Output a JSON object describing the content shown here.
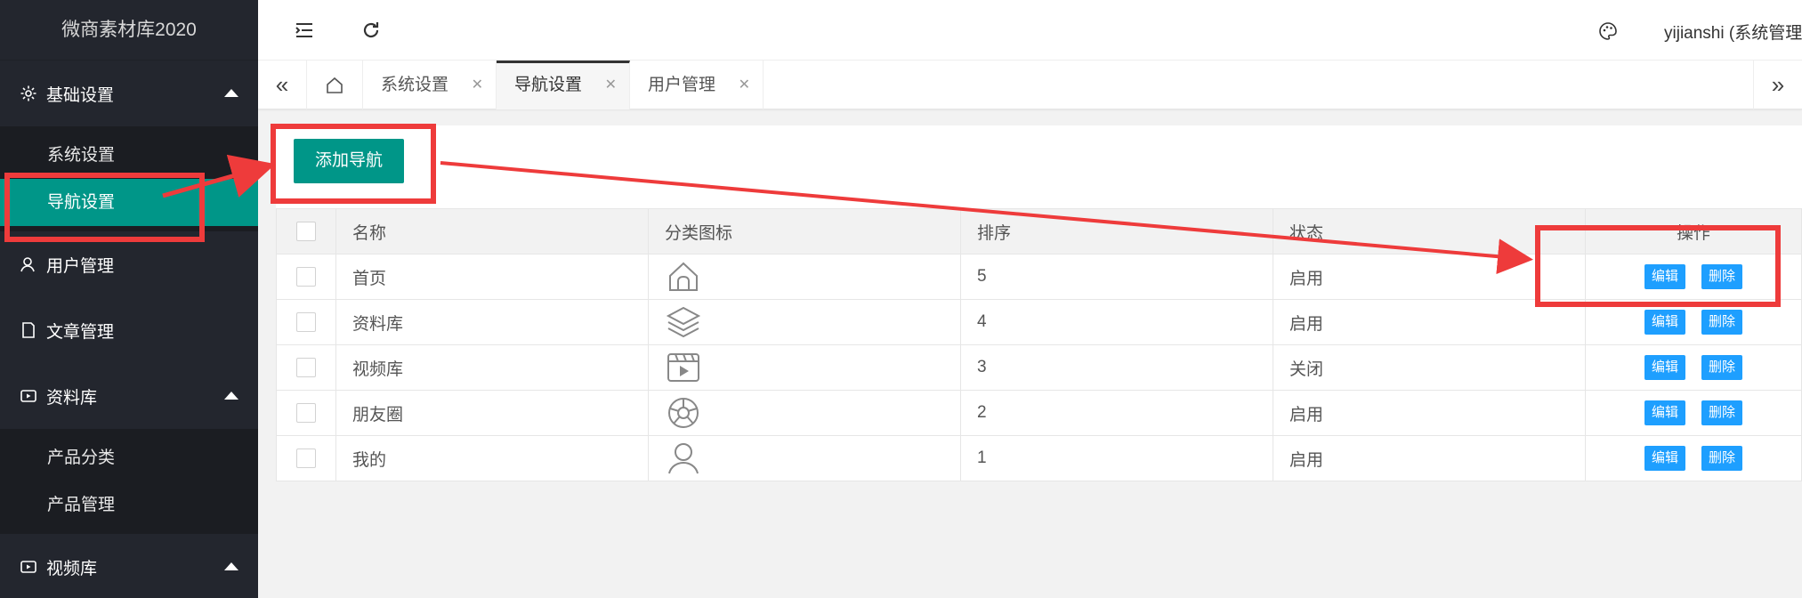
{
  "app": {
    "title": "微商素材库2020"
  },
  "header": {
    "user": "yijianshi (系统管理"
  },
  "sidebar": {
    "groups": [
      {
        "label": "基础设置",
        "icon": "gear-icon",
        "children": [
          "系统设置",
          "导航设置"
        ]
      },
      {
        "label": "用户管理",
        "icon": "user-icon"
      },
      {
        "label": "文章管理",
        "icon": "document-icon"
      },
      {
        "label": "资料库",
        "icon": "media-icon",
        "children": [
          "产品分类",
          "产品管理"
        ]
      },
      {
        "label": "视频库",
        "icon": "media-icon"
      }
    ],
    "active_item": "导航设置"
  },
  "tabs": [
    {
      "label": "系统设置",
      "active": false
    },
    {
      "label": "导航设置",
      "active": true
    },
    {
      "label": "用户管理",
      "active": false
    }
  ],
  "toolbar": {
    "add_label": "添加导航"
  },
  "table": {
    "headers": [
      "名称",
      "分类图标",
      "排序",
      "状态",
      "操作"
    ],
    "rows": [
      {
        "name": "首页",
        "icon": "home-icon",
        "order": "5",
        "status": "启用"
      },
      {
        "name": "资料库",
        "icon": "layers-icon",
        "order": "4",
        "status": "启用"
      },
      {
        "name": "视频库",
        "icon": "video-icon",
        "order": "3",
        "status": "关闭"
      },
      {
        "name": "朋友圈",
        "icon": "aperture-icon",
        "order": "2",
        "status": "启用"
      },
      {
        "name": "我的",
        "icon": "person-icon",
        "order": "1",
        "status": "启用"
      }
    ],
    "edit_label": "编辑",
    "delete_label": "删除"
  },
  "colors": {
    "accent": "#009688",
    "sidebar": "#23262e",
    "mini_button": "#1e9fff",
    "annotation": "#ee3b3b"
  }
}
